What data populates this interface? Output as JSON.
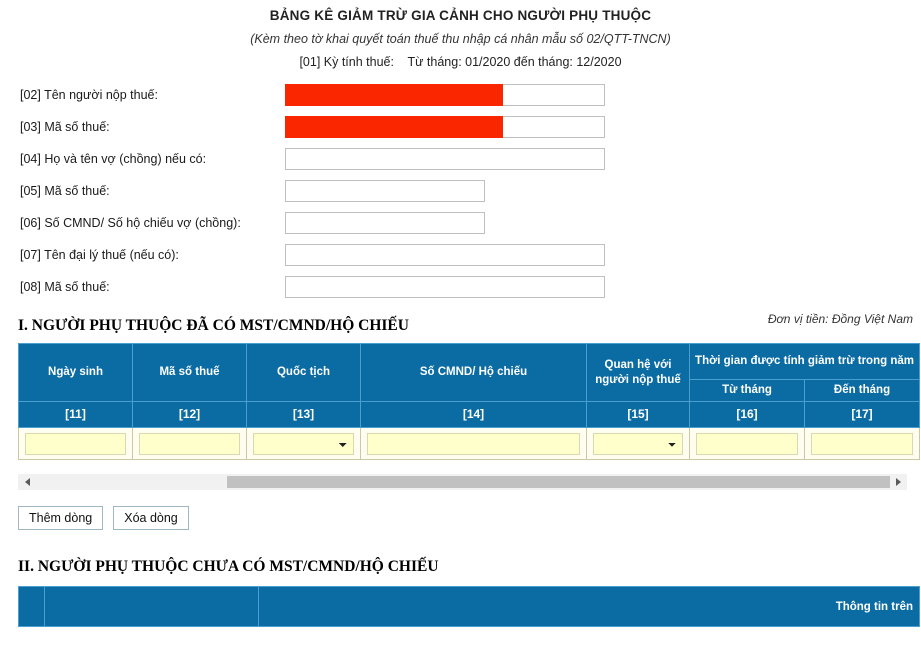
{
  "document": {
    "title": "BẢNG KÊ GIẢM TRỪ GIA CẢNH CHO NGƯỜI PHỤ THUỘC",
    "subtitle": "(Kèm theo tờ khai quyết toán thuế thu nhập cá nhân mẫu số 02/QTT-TNCN)",
    "period_label": "[01] Kỳ tính thuế:",
    "period_value": "Từ tháng: 01/2020 đến tháng: 12/2020",
    "currency_note": "Đơn vị tiền: Đồng Việt Nam"
  },
  "form": {
    "fields": [
      {
        "label": "[02] Tên người nộp thuế:",
        "value": "",
        "redacted": true,
        "width": "long"
      },
      {
        "label": "[03] Mã số thuế:",
        "value": "",
        "redacted": true,
        "width": "long"
      },
      {
        "label": "[04] Họ và tên vợ (chồng) nếu có:",
        "value": "",
        "redacted": false,
        "width": "long"
      },
      {
        "label": "[05] Mã số thuế:",
        "value": "",
        "redacted": false,
        "width": "short"
      },
      {
        "label": "[06] Số CMND/ Số hộ chiếu vợ (chồng):",
        "value": "",
        "redacted": false,
        "width": "short"
      },
      {
        "label": "[07] Tên đại lý thuế (nếu có):",
        "value": "",
        "redacted": false,
        "width": "long"
      },
      {
        "label": "[08] Mã số thuế:",
        "value": "",
        "redacted": false,
        "width": "long"
      }
    ]
  },
  "section1": {
    "heading": "I. NGƯỜI PHỤ THUỘC ĐÃ CÓ MST/CMND/HỘ CHIẾU",
    "headers": {
      "ngay_sinh": "Ngày sinh",
      "ma_so_thue": "Mã số thuế",
      "quoc_tich": "Quốc tịch",
      "so_cmnd": "Số CMND/ Hộ chiếu",
      "quan_he": "Quan hệ với người nộp thuế",
      "thoi_gian": "Thời gian được tính giảm trừ trong năm",
      "tu_thang": "Từ tháng",
      "den_thang": "Đến tháng"
    },
    "codes": {
      "c11": "[11]",
      "c12": "[12]",
      "c13": "[13]",
      "c14": "[14]",
      "c15": "[15]",
      "c16": "[16]",
      "c17": "[17]"
    },
    "row": {
      "ngay_sinh": "",
      "ma_so_thue": "",
      "quoc_tich": "",
      "so_cmnd": "",
      "quan_he": "",
      "tu_thang": "",
      "den_thang": ""
    },
    "buttons": {
      "add_row": "Thêm dòng",
      "delete_row": "Xóa dòng"
    }
  },
  "section2": {
    "heading": "II. NGƯỜI PHỤ THUỘC CHƯA CÓ MST/CMND/HỘ CHIẾU",
    "headers": {
      "col1": "",
      "col2": "",
      "col3": "Thông tin trên"
    }
  },
  "colors": {
    "header_blue": "#0b6ba3",
    "cell_border": "#4a9fd0",
    "input_yellow": "#ffffcc",
    "redaction_red": "#fa2600",
    "scrollbar_thumb": "#c1c1c1"
  }
}
